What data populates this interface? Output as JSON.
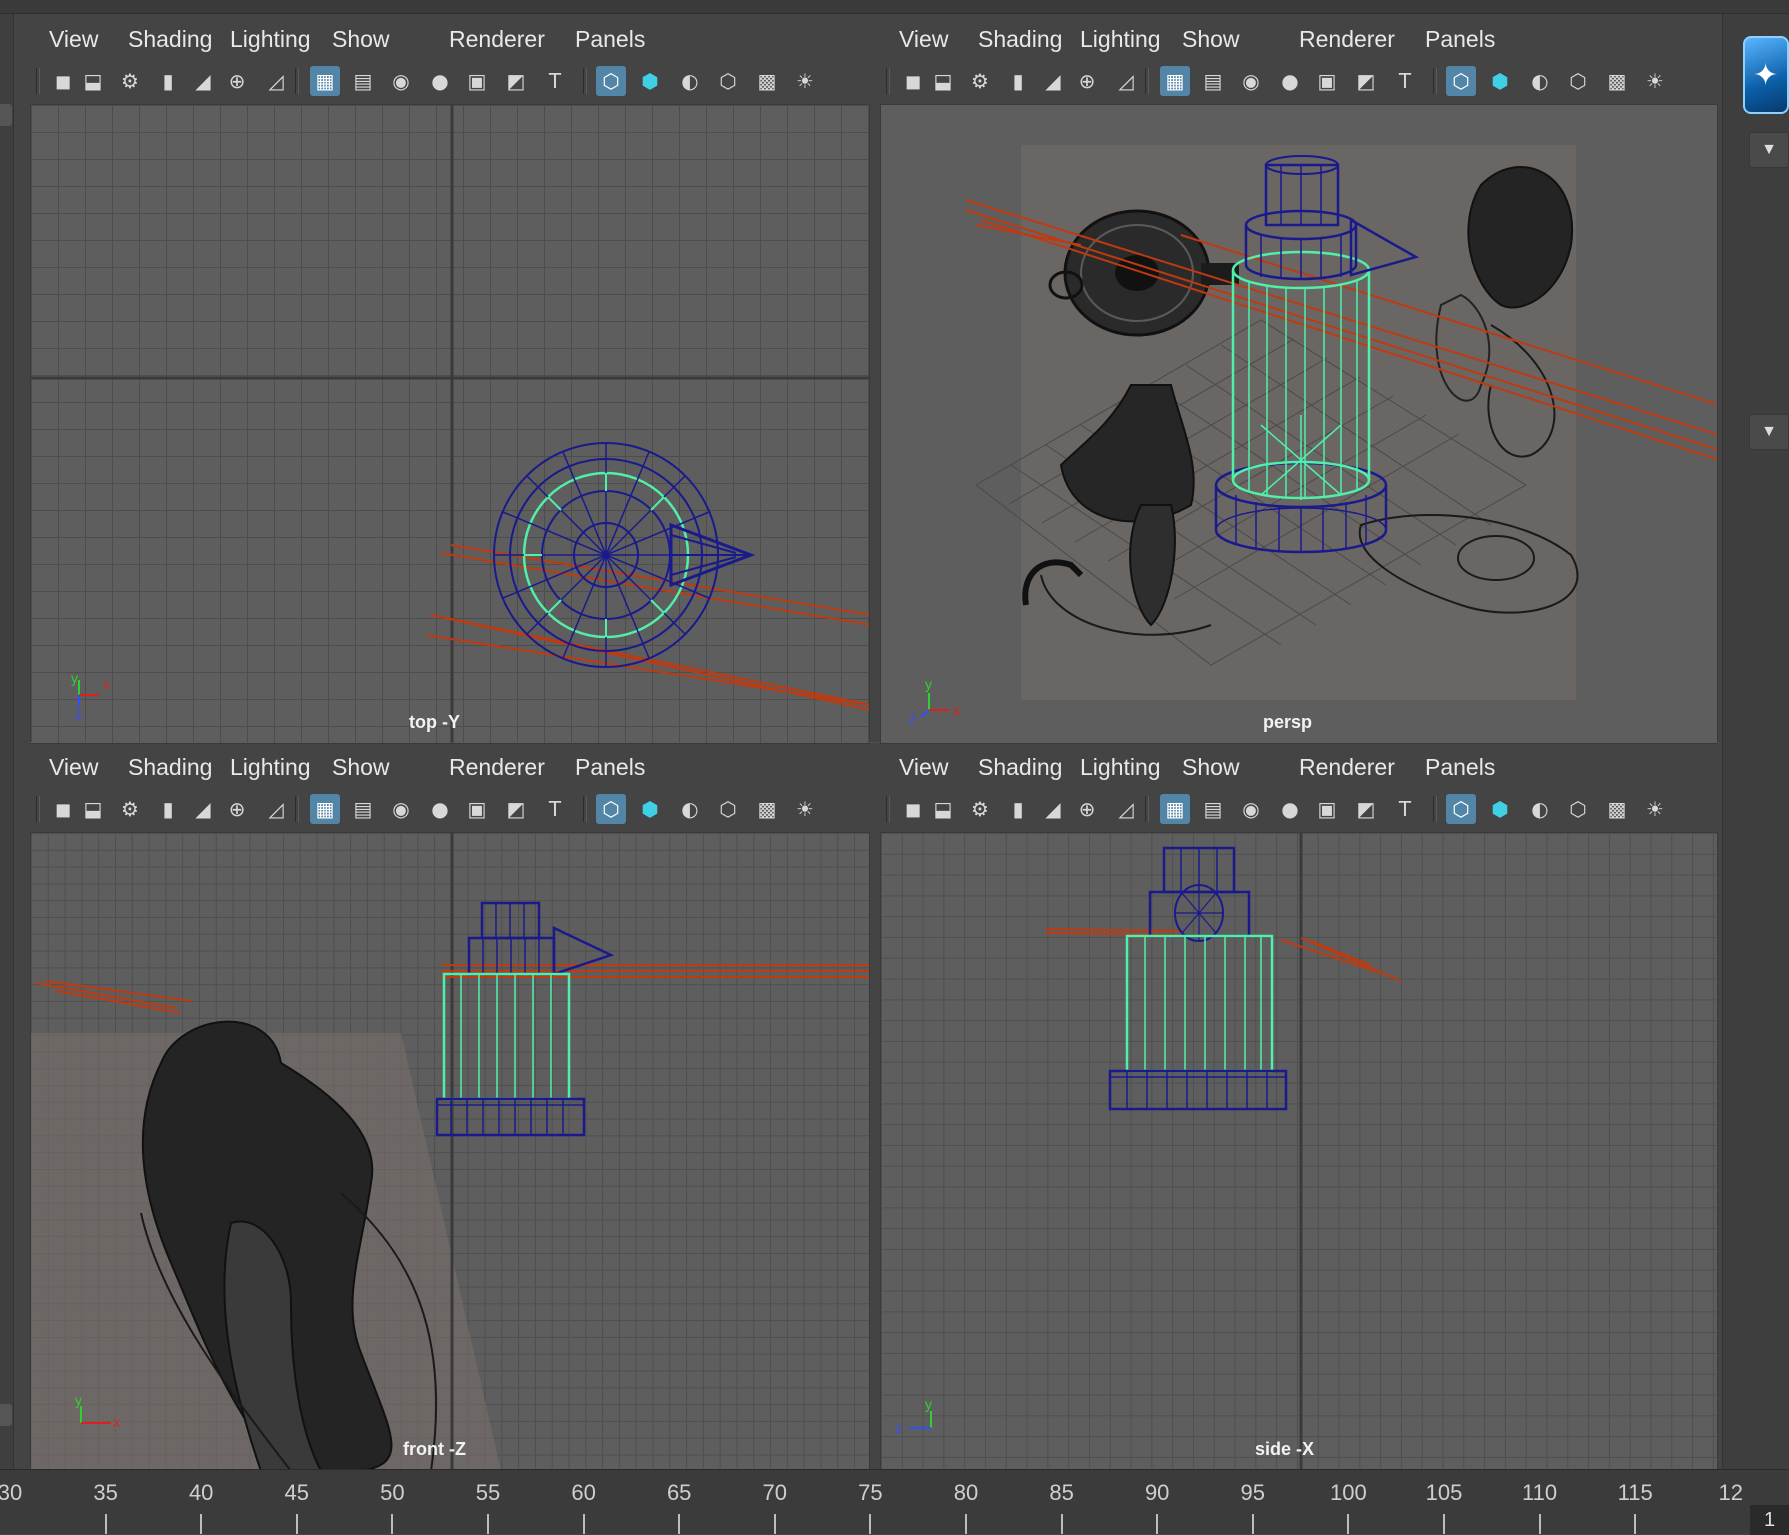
{
  "menus": [
    "View",
    "Shading",
    "Lighting",
    "Show",
    "Renderer",
    "Panels"
  ],
  "icons": {
    "camera_tools": [
      "camera-icon",
      "camera-lock-icon",
      "camera-attributes-icon",
      "bookmark-icon",
      "grease-pencil-icon",
      "2d-pan-zoom-icon",
      "image-plane-icon"
    ],
    "display_toggles": [
      "grid-icon",
      "film-gate-icon",
      "resolution-gate-icon",
      "gate-mask-icon",
      "field-chart-icon",
      "safe-action-icon",
      "safe-title-icon"
    ],
    "shading_toggles": [
      "wireframe-icon",
      "smooth-shade-icon",
      "use-default-material-icon",
      "wireframe-on-shaded-icon",
      "xray-icon",
      "lighting-icon"
    ]
  },
  "viewports": [
    {
      "id": "top",
      "label": "top -Y",
      "axis_labels": [
        "y",
        "x",
        "z"
      ]
    },
    {
      "id": "persp",
      "label": "persp",
      "axis_labels": [
        "y",
        "x",
        "z"
      ]
    },
    {
      "id": "front",
      "label": "front -Z",
      "axis_labels": [
        "y",
        "x"
      ]
    },
    {
      "id": "side",
      "label": "side -X",
      "axis_labels": [
        "y",
        "z"
      ]
    }
  ],
  "timeline": {
    "ticks": [
      "30",
      "35",
      "40",
      "45",
      "50",
      "55",
      "60",
      "65",
      "70",
      "75",
      "80",
      "85",
      "90",
      "95",
      "100",
      "105",
      "110",
      "115",
      "12"
    ],
    "current_frame": "1"
  },
  "colors": {
    "accent": "#5285a6",
    "wire_selected": "#50f0a8",
    "wire_navy": "#1a1a8c",
    "light_line": "#c03a10"
  }
}
